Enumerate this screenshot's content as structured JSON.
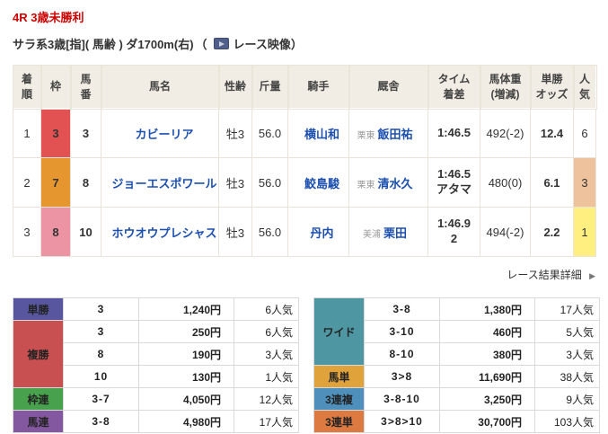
{
  "header": {
    "race_title": "4R 3歳未勝利",
    "race_conditions": "サラ系3歳[指]( 馬齢 ) ダ1700m(右)",
    "video_paren_open": "（",
    "video_label": "レース映像",
    "video_paren_close": "）",
    "title_color": "#cc0000",
    "video_icon": "play-video-icon"
  },
  "results": {
    "columns": [
      "着\n順",
      "枠",
      "馬\n番",
      "馬名",
      "性齢",
      "斤量",
      "騎手",
      "厩舎",
      "タイム\n着差",
      "馬体重\n(増減)",
      "単勝\nオッズ",
      "人\n気"
    ],
    "rows": [
      {
        "pos": "1",
        "frame": "3",
        "frame_color": "#e25252",
        "number": "3",
        "name": "カビーリア",
        "sex_age": "牡3",
        "weight": "56.0",
        "jockey": "横山和",
        "region": "栗東",
        "trainer": "飯田祐",
        "time": "1:46.5",
        "horse_weight": "492(-2)",
        "odds": "12.4",
        "fav": "6",
        "fav_bg": ""
      },
      {
        "pos": "2",
        "frame": "7",
        "frame_color": "#e6962f",
        "number": "8",
        "name": "ジョーエスポワール",
        "sex_age": "牡3",
        "weight": "56.0",
        "jockey": "鮫島駿",
        "region": "栗東",
        "trainer": "清水久",
        "time": "1:46.5\nアタマ",
        "horse_weight": "480(0)",
        "odds": "6.1",
        "fav": "3",
        "fav_bg": "#edc29c"
      },
      {
        "pos": "3",
        "frame": "8",
        "frame_color": "#ec93a4",
        "number": "10",
        "name": "ホウオウプレシャス",
        "sex_age": "牡3",
        "weight": "56.0",
        "jockey": "丹内",
        "region": "美浦",
        "trainer": "栗田",
        "time": "1:46.9\n2",
        "horse_weight": "494(-2)",
        "odds": "2.2",
        "fav": "1",
        "fav_bg": "#ffef80"
      }
    ]
  },
  "detail_link": {
    "label": "レース結果詳細",
    "arrow": "▶"
  },
  "payout_left": {
    "groups": [
      {
        "label": "単勝",
        "color": "#57569e",
        "rows": [
          {
            "combo": "3",
            "amount": "1,240円",
            "fav": "6人気"
          }
        ]
      },
      {
        "label": "複勝",
        "color": "#c85050",
        "rows": [
          {
            "combo": "3",
            "amount": "250円",
            "fav": "6人気"
          },
          {
            "combo": "8",
            "amount": "190円",
            "fav": "3人気"
          },
          {
            "combo": "10",
            "amount": "130円",
            "fav": "1人気"
          }
        ]
      },
      {
        "label": "枠連",
        "color": "#48a14c",
        "rows": [
          {
            "combo": "3-7",
            "amount": "4,050円",
            "fav": "12人気"
          }
        ]
      },
      {
        "label": "馬連",
        "color": "#8458a0",
        "rows": [
          {
            "combo": "3-8",
            "amount": "4,980円",
            "fav": "17人気"
          }
        ]
      }
    ]
  },
  "payout_right": {
    "groups": [
      {
        "label": "ワイド",
        "color": "#4d96a2",
        "rows": [
          {
            "combo": "3-8",
            "amount": "1,380円",
            "fav": "17人気"
          },
          {
            "combo": "3-10",
            "amount": "460円",
            "fav": "5人気"
          },
          {
            "combo": "8-10",
            "amount": "380円",
            "fav": "3人気"
          }
        ]
      },
      {
        "label": "馬単",
        "color": "#e0a33c",
        "rows": [
          {
            "combo": "3>8",
            "amount": "11,690円",
            "fav": "38人気"
          }
        ]
      },
      {
        "label": "3連複",
        "color": "#4e8fbb",
        "rows": [
          {
            "combo": "3-8-10",
            "amount": "3,250円",
            "fav": "9人気"
          }
        ]
      },
      {
        "label": "3連単",
        "color": "#dd7a41",
        "rows": [
          {
            "combo": "3>8>10",
            "amount": "30,700円",
            "fav": "103人気"
          }
        ]
      }
    ]
  }
}
